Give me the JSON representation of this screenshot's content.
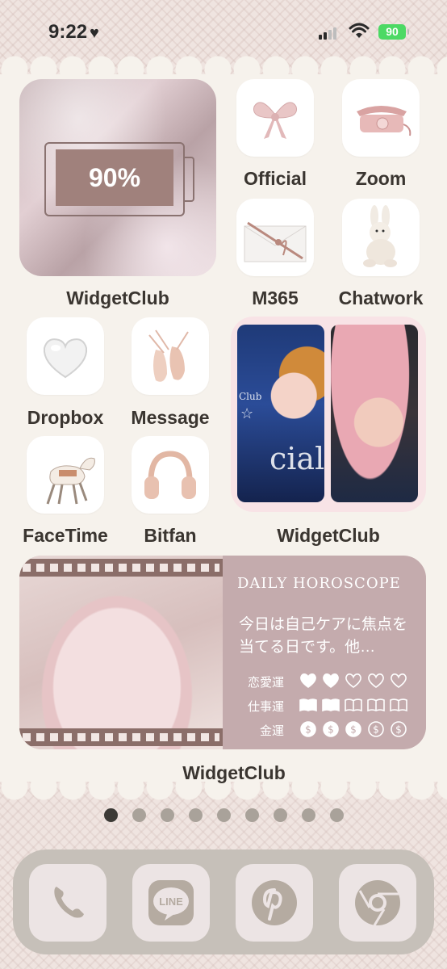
{
  "status": {
    "time": "9:22",
    "battery": "90"
  },
  "widgets": {
    "battery_percent": "90%",
    "battery_label": "WidgetClub",
    "photo_label": "WidgetClub",
    "horoscope_label": "WidgetClub",
    "photo_texts": [
      "Club",
      "☆",
      "cial"
    ]
  },
  "apps": [
    {
      "label": "Official",
      "icon": "bow-icon"
    },
    {
      "label": "Zoom",
      "icon": "pink-telephone-icon"
    },
    {
      "label": "M365",
      "icon": "envelope-ribbon-icon"
    },
    {
      "label": "Chatwork",
      "icon": "bunny-plush-icon"
    },
    {
      "label": "Dropbox",
      "icon": "glass-heart-icon"
    },
    {
      "label": "Message",
      "icon": "ballet-shoes-icon"
    },
    {
      "label": "FaceTime",
      "icon": "carousel-horse-icon"
    },
    {
      "label": "Bitfan",
      "icon": "headphones-icon"
    }
  ],
  "horoscope": {
    "title": "DAILY HOROSCOPE",
    "message": "今日は自己ケアに焦点を当てる日です。他…",
    "rows": [
      {
        "label": "恋愛運",
        "filled": 2,
        "total": 5,
        "icon": "heart-icon"
      },
      {
        "label": "仕事運",
        "filled": 2,
        "total": 5,
        "icon": "book-icon"
      },
      {
        "label": "金運",
        "filled": 3,
        "total": 5,
        "icon": "coin-icon"
      }
    ]
  },
  "page_indicator": {
    "count": 9,
    "active": 0
  },
  "dock": [
    {
      "icon": "phone-icon"
    },
    {
      "icon": "line-icon",
      "text": "LINE"
    },
    {
      "icon": "pinterest-icon"
    },
    {
      "icon": "chrome-icon"
    }
  ],
  "colors": {
    "accent": "#a0817c",
    "horoscope_panel": "#c4abad",
    "dock": "#c6c0b9",
    "battery_green": "#4cd964"
  }
}
